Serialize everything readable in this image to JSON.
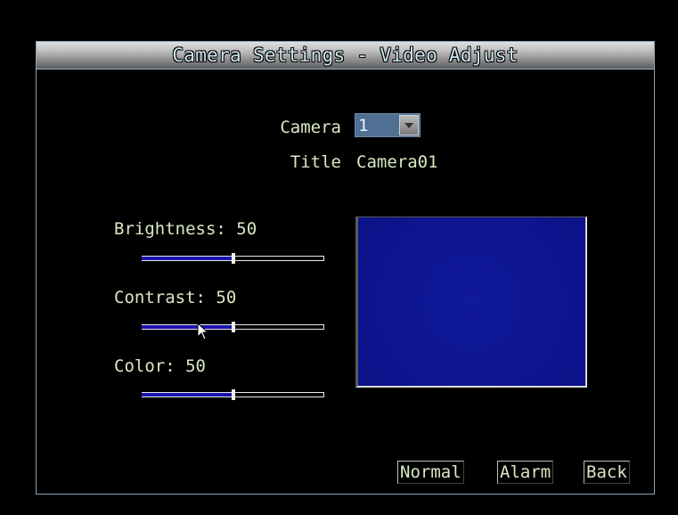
{
  "window": {
    "title": "Camera Settings - Video Adjust"
  },
  "camera": {
    "label": "Camera",
    "selected": "1"
  },
  "title_field": {
    "label": "Title",
    "value": "Camera01"
  },
  "adjustments": {
    "brightness": {
      "label": "Brightness:",
      "value": "50",
      "level": 0.5
    },
    "contrast": {
      "label": "Contrast:",
      "value": "50",
      "level": 0.5
    },
    "color": {
      "label": "Color:",
      "value": "50",
      "level": 0.5
    }
  },
  "buttons": {
    "normal": "Normal",
    "alarm": "Alarm",
    "back": "Back"
  },
  "colors": {
    "text": "#d9e8c3",
    "preview": "#0b1289",
    "slider_fill": "#1a12b0"
  }
}
